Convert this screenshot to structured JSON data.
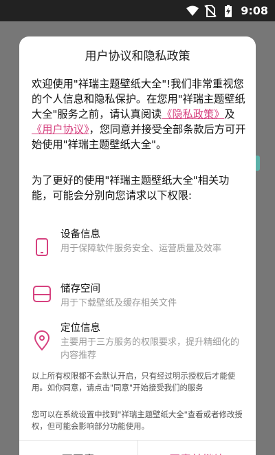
{
  "status_bar": {
    "time": "9:08",
    "icons": [
      "wifi-icon",
      "no-sim-icon",
      "battery-charging-icon"
    ]
  },
  "dialog": {
    "title": "用户协议和隐私政策",
    "intro": {
      "line1_prefix": "欢迎使用\"祥瑞主题壁纸大全\"!我们非常重视您的个人信息和隐私保护。在您用\"祥瑞主题壁纸大全\"服务之前，请认真阅读",
      "privacy_link": "《隐私政策》",
      "and": "及",
      "agreement_link": "《用户协议》",
      "suffix": "，您同意并接受全部条款后方可开始使用\"祥瑞主题壁纸大全\"。"
    },
    "permissions_intro": "为了更好的使用\"祥瑞主题壁纸大全\"相关功能，可能会分别向您请求以下权限:",
    "permissions": [
      {
        "icon": "phone-device-icon",
        "title": "设备信息",
        "desc": "用于保障软件服务安全、运营质量及效率"
      },
      {
        "icon": "storage-icon",
        "title": "储存空间",
        "desc": "用于下载壁纸及缓存相关文件"
      },
      {
        "icon": "location-pin-icon",
        "title": "定位信息",
        "desc": "主要用于三方服务的权限要求，提升精细化的内容推荐"
      }
    ],
    "note1": "以上所有权限都不会默认开启，只有经过明示授权后才能使用。如你同意，请点击\"同意\"开始接受我们的服务",
    "note2": "您可以在系统设置中找到\"祥瑞主题壁纸大全\"查看或者修改授权，但可能会影响部分功能使用。",
    "buttons": {
      "disagree": "不同意",
      "agree": "同意并继续"
    }
  },
  "colors": {
    "accent": "#d6417f",
    "overlay": "#777777",
    "status_bar": "#222222"
  }
}
